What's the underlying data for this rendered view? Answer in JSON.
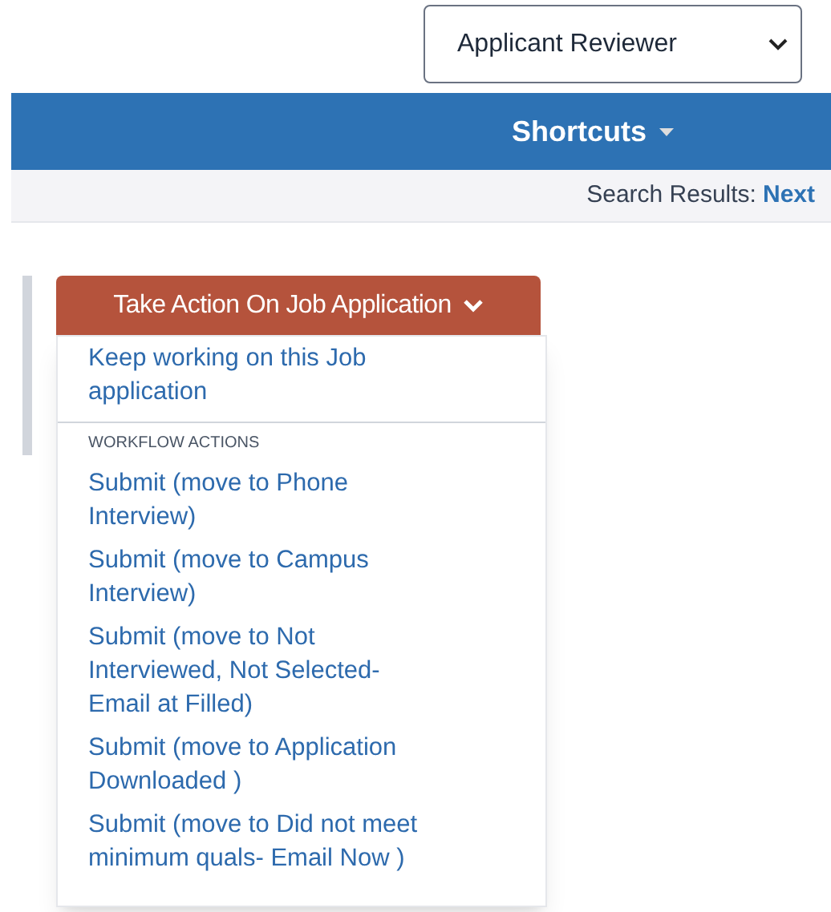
{
  "role_select": {
    "value": "Applicant Reviewer"
  },
  "navbar": {
    "shortcuts": "Shortcuts"
  },
  "search_results": {
    "label": "Search Results:",
    "link": "Next"
  },
  "action_button": {
    "label": "Take Action On Job Application",
    "expanded": true
  },
  "menu": {
    "items": [
      {
        "kind": "link",
        "label": "Keep working on this Job application"
      },
      {
        "kind": "divider"
      },
      {
        "kind": "header",
        "label": "WORKFLOW ACTIONS"
      },
      {
        "kind": "link",
        "label": "Submit (move to Phone Interview)"
      },
      {
        "kind": "link",
        "label": "Submit (move to Campus Interview)"
      },
      {
        "kind": "link",
        "label": "Submit (move to Not Interviewed, Not Selected- Email at Filled)"
      },
      {
        "kind": "link",
        "label": "Submit (move to Application Downloaded )"
      },
      {
        "kind": "link",
        "label": "Submit (move to Did not meet minimum quals- Email Now )"
      }
    ]
  }
}
